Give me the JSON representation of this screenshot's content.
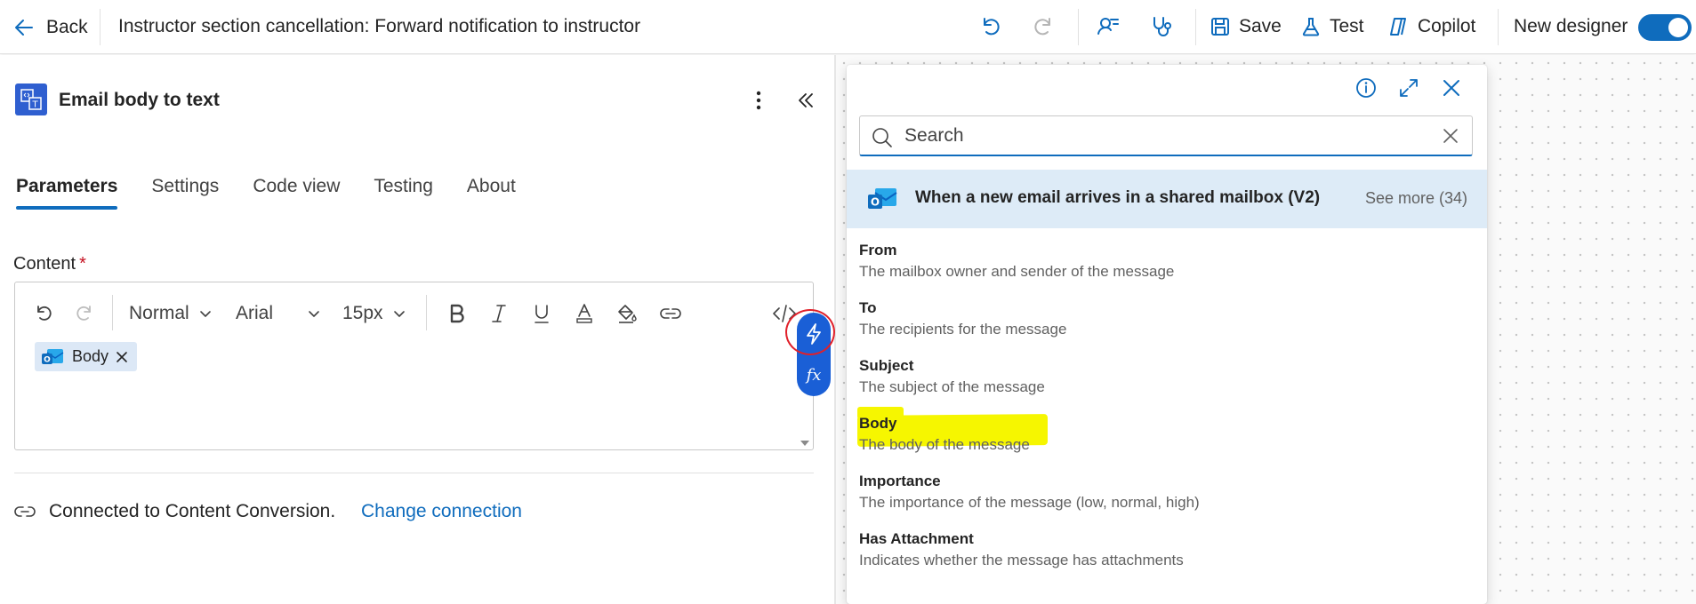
{
  "topbar": {
    "back_label": "Back",
    "title": "Instructor section cancellation: Forward notification to instructor",
    "save_label": "Save",
    "test_label": "Test",
    "copilot_label": "Copilot",
    "new_designer_label": "New designer",
    "new_designer_on": true
  },
  "action": {
    "title": "Email body to text",
    "tabs": [
      "Parameters",
      "Settings",
      "Code view",
      "Testing",
      "About"
    ],
    "active_tab": "Parameters"
  },
  "content_field": {
    "label": "Content",
    "required_mark": "*",
    "format_value": "Normal",
    "font_value": "Arial",
    "size_value": "15px",
    "token_label": "Body"
  },
  "connection": {
    "text": "Connected to Content Conversion.",
    "link": "Change connection"
  },
  "popup": {
    "search_placeholder": "Search",
    "group_title": "When a new email arrives in a shared mailbox (V2)",
    "group_see_more": "See more (34)",
    "items": [
      {
        "name": "From",
        "desc": "The mailbox owner and sender of the message"
      },
      {
        "name": "To",
        "desc": "The recipients for the message"
      },
      {
        "name": "Subject",
        "desc": "The subject of the message"
      },
      {
        "name": "Body",
        "desc": "The body of the message"
      },
      {
        "name": "Importance",
        "desc": "The importance of the message (low, normal, high)"
      },
      {
        "name": "Has Attachment",
        "desc": "Indicates whether the message has attachments"
      }
    ]
  },
  "colors": {
    "accent": "#0f6cbd",
    "highlight": "#f6f600",
    "annotation": "#e0202a"
  },
  "icons": [
    "arrow-left-icon",
    "undo-icon",
    "redo-icon",
    "flow-checker-icon",
    "stethoscope-icon",
    "save-icon",
    "flask-icon",
    "copilot-icon",
    "more-vertical-icon",
    "double-chevron-left-icon",
    "bold-icon",
    "italic-icon",
    "underline-icon",
    "font-color-icon",
    "paint-bucket-icon",
    "link-icon",
    "code-view-icon",
    "lightning-icon",
    "fx-icon",
    "info-icon",
    "expand-icon",
    "close-icon",
    "search-icon",
    "outlook-icon",
    "connection-icon"
  ]
}
